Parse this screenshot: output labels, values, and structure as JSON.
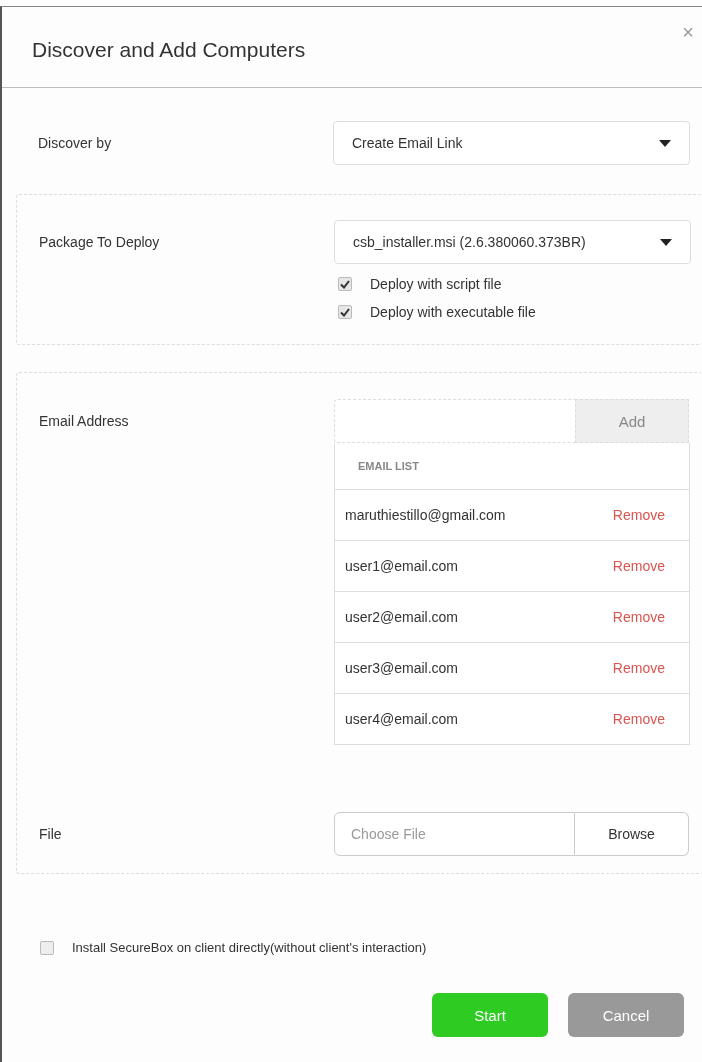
{
  "dialog": {
    "title": "Discover and Add Computers",
    "close": "×"
  },
  "discover_by": {
    "label": "Discover by",
    "value": "Create Email Link"
  },
  "package": {
    "label": "Package To Deploy",
    "value": "csb_installer.msi (2.6.380060.373BR)",
    "options": [
      {
        "label": "Deploy with script file",
        "checked": true
      },
      {
        "label": "Deploy with executable file",
        "checked": true
      }
    ]
  },
  "email": {
    "label": "Email Address",
    "add_button": "Add",
    "list_header": "EMAIL LIST",
    "rows": [
      {
        "address": "maruthiestillo@gmail.com",
        "action": "Remove"
      },
      {
        "address": "user1@email.com",
        "action": "Remove"
      },
      {
        "address": "user2@email.com",
        "action": "Remove"
      },
      {
        "address": "user3@email.com",
        "action": "Remove"
      },
      {
        "address": "user4@email.com",
        "action": "Remove"
      }
    ]
  },
  "file": {
    "label": "File",
    "placeholder": "Choose File",
    "button": "Browse"
  },
  "install_directly": {
    "label": "Install SecureBox on client directly(without client's interaction)",
    "checked": false
  },
  "buttons": {
    "start": "Start",
    "cancel": "Cancel"
  }
}
